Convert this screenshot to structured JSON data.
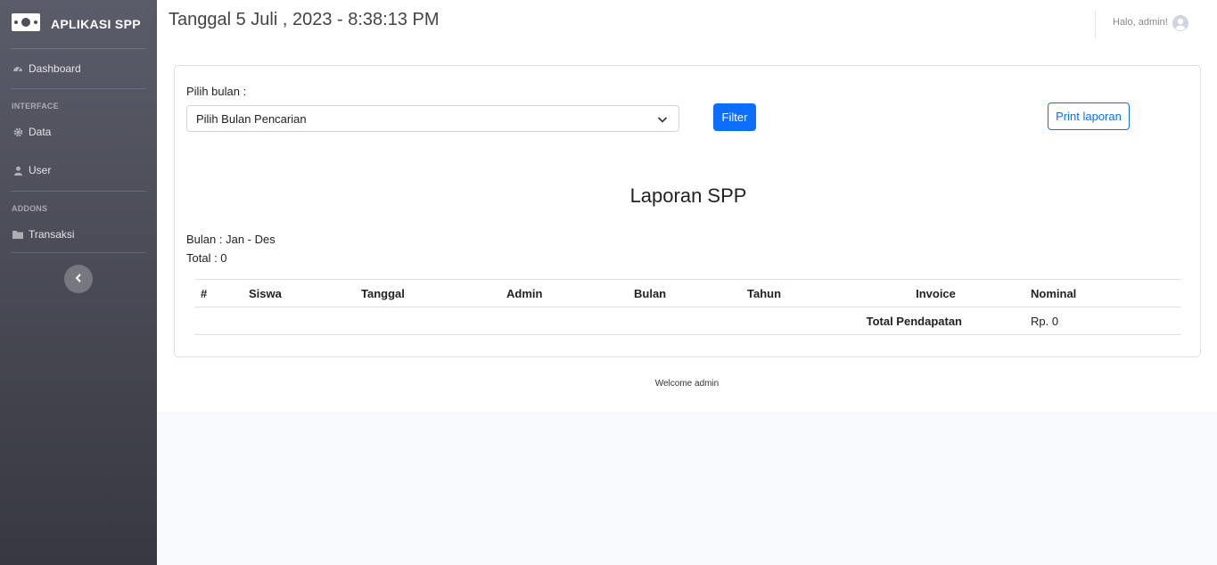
{
  "sidebar": {
    "brand": "APLIKASI SPP",
    "items": [
      {
        "label": "Dashboard",
        "icon": "dashboard-icon"
      },
      {
        "heading": "INTERFACE"
      },
      {
        "label": "Data",
        "icon": "gear-icon"
      },
      {
        "label": "User",
        "icon": "user-icon"
      },
      {
        "heading": "ADDONS"
      },
      {
        "label": "Transaksi",
        "icon": "folder-icon"
      }
    ]
  },
  "topbar": {
    "datetime": "Tanggal 5 Juli , 2023 - 8:38:13 PM",
    "greeting": "Halo, admin!"
  },
  "filter": {
    "label": "Pilih bulan :",
    "select_value": "Pilih Bulan Pencarian",
    "filter_button": "Filter",
    "print_button": "Print laporan"
  },
  "report": {
    "title": "Laporan SPP",
    "bulan": "Bulan : Jan - Des",
    "total": "Total : 0",
    "columns": [
      "#",
      "Siswa",
      "Tanggal",
      "Admin",
      "Bulan",
      "Tahun",
      "Invoice",
      "Nominal"
    ],
    "total_label": "Total Pendapatan",
    "total_value": "Rp. 0"
  },
  "footer": "Welcome admin",
  "colors": {
    "primary": "#0d6efd",
    "sidebar_top": "#5a5c69",
    "sidebar_bottom": "#373840"
  }
}
